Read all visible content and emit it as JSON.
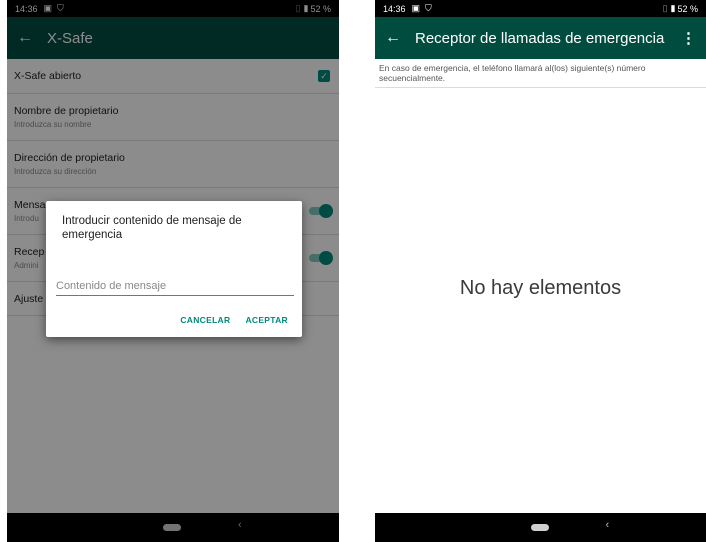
{
  "colors": {
    "appbar": "#004d40",
    "appbar_dim": "#002a24",
    "accent": "#00897b",
    "nav": "#000000"
  },
  "left": {
    "status": {
      "time": "14:36",
      "battery": "52 %"
    },
    "appbar": {
      "title": "X-Safe"
    },
    "prefs": [
      {
        "title": "X-Safe abierto",
        "summary": "",
        "control": "checkbox"
      },
      {
        "title": "Nombre de propietario",
        "summary": "Introduzca su nombre",
        "control": ""
      },
      {
        "title": "Dirección de propietario",
        "summary": "Introduzca su dirección",
        "control": ""
      },
      {
        "title": "Mensa",
        "summary": "Introdu",
        "control": "switch"
      },
      {
        "title": "Recep",
        "summary": "Admini",
        "control": "switch"
      },
      {
        "title": "Ajuste",
        "summary": "",
        "control": ""
      }
    ],
    "dialog": {
      "title": "Introducir contenido de mensaje de emergencia",
      "input_placeholder": "Contenido de mensaje",
      "cancel": "CANCELAR",
      "accept": "ACEPTAR"
    },
    "navbar": {
      "back_glyph": "‹"
    }
  },
  "right": {
    "status": {
      "time": "14:36",
      "battery": "52 %"
    },
    "appbar": {
      "title": "Receptor de llamadas de emergencia"
    },
    "header_text": "En caso de emergencia, el teléfono llamará al(los) siguiente(s) número secuencialmente.",
    "empty_text": "No hay elementos",
    "navbar": {
      "back_glyph": "‹"
    }
  }
}
